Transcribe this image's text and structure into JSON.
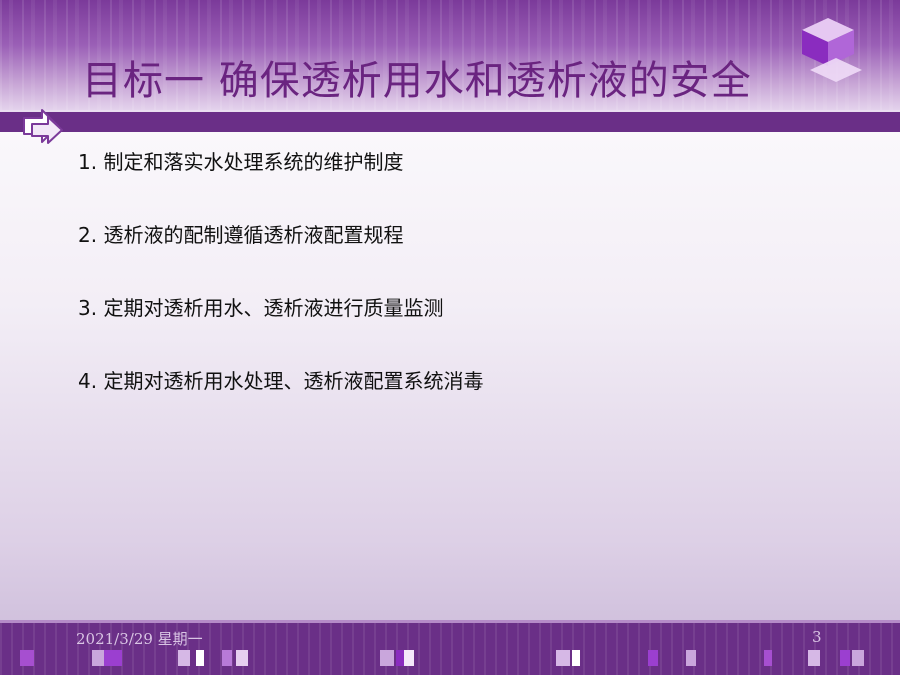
{
  "slide": {
    "title": "目标一  确保透析用水和透析液的安全",
    "items": [
      "1.  制定和落实水处理系统的维护制度",
      "2. 透析液的配制遵循透析液配置规程",
      "3. 定期对透析用水、透析液进行质量监测",
      "4. 定期对透析用水处理、透析液配置系统消毒"
    ]
  },
  "footer": {
    "date": "2021/3/29 星期一",
    "page_number": "3"
  },
  "colors": {
    "accent": "#6a2f87",
    "title": "#6a2480",
    "cube_light": "#e6c8f2",
    "cube_mid": "#b066d8",
    "cube_dark": "#8a2cbf"
  },
  "icons": [
    "cube-logo-icon",
    "double-arrow-icon"
  ]
}
